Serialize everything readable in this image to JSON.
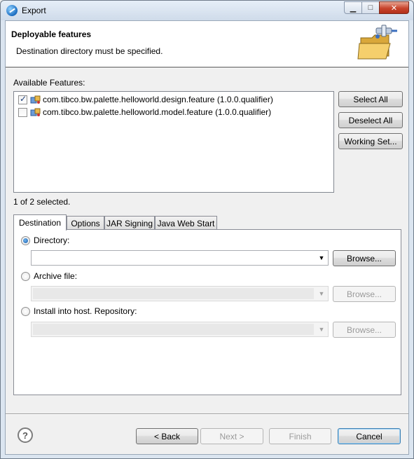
{
  "window": {
    "title": "Export",
    "controls": {
      "minimize": "▁",
      "maximize": "□",
      "close": "✕"
    }
  },
  "banner": {
    "title": "Deployable features",
    "message": "Destination directory must be specified."
  },
  "features": {
    "label": "Available Features:",
    "items": [
      {
        "label": "com.tibco.bw.palette.helloworld.design.feature (1.0.0.qualifier)",
        "checked": true
      },
      {
        "label": "com.tibco.bw.palette.helloworld.model.feature (1.0.0.qualifier)",
        "checked": false
      }
    ],
    "status": "1 of 2 selected.",
    "buttons": {
      "select_all": "Select All",
      "deselect_all": "Deselect All",
      "working_set": "Working Set..."
    }
  },
  "tabs": [
    {
      "label": "Destination",
      "active": true
    },
    {
      "label": "Options",
      "active": false
    },
    {
      "label": "JAR Signing",
      "active": false
    },
    {
      "label": "Java Web Start",
      "active": false
    }
  ],
  "destination": {
    "directory": {
      "label": "Directory:",
      "selected": true,
      "value": "",
      "browse": "Browse..."
    },
    "archive": {
      "label": "Archive file:",
      "selected": false,
      "value": "",
      "browse": "Browse..."
    },
    "install": {
      "label": "Install into host. Repository:",
      "selected": false,
      "value": "",
      "browse": "Browse..."
    }
  },
  "footer": {
    "help": "?",
    "back": "< Back",
    "next": "Next >",
    "finish": "Finish",
    "cancel": "Cancel"
  },
  "icons": {
    "app": "eclipse-icon",
    "banner": "export-folder-icon",
    "feature": "feature-plugin-icon",
    "dropdown": "chevron-down-icon",
    "help": "help-icon"
  }
}
